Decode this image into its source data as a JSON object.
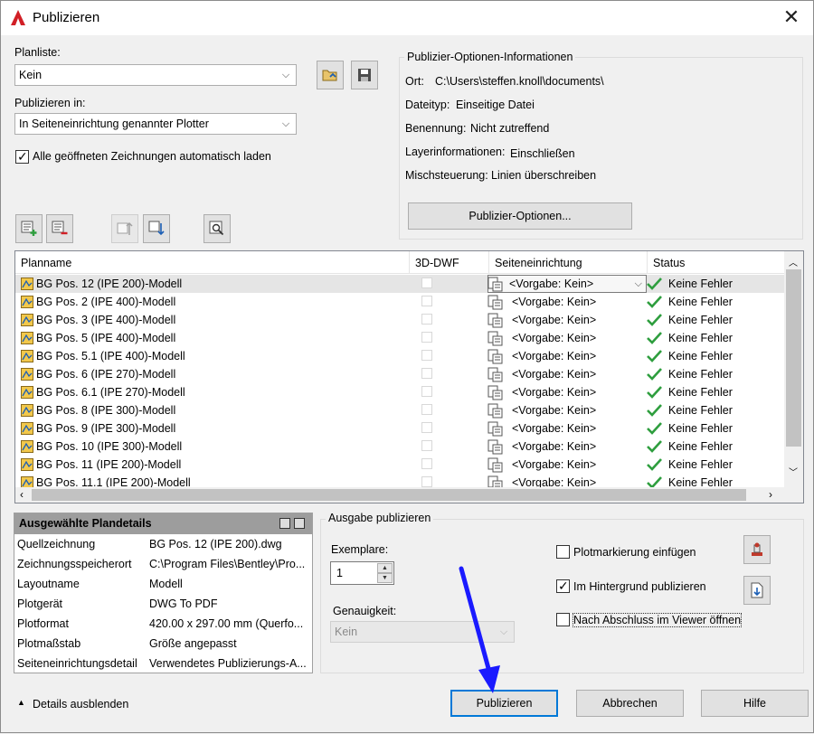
{
  "window": {
    "title": "Publizieren"
  },
  "planliste": {
    "label": "Planliste:",
    "value": "Kein"
  },
  "publizieren_in": {
    "label": "Publizieren in:",
    "value": "In Seiteneinrichtung genannter Plotter"
  },
  "auto_load": {
    "label": "Alle geöffneten Zeichnungen automatisch laden",
    "checked": true
  },
  "info": {
    "title": "Publizier-Optionen-Informationen",
    "rows": [
      {
        "key": "Ort:",
        "value": "C:\\Users\\steffen.knoll\\documents\\"
      },
      {
        "key": "Dateityp:",
        "value": "Einseitige Datei"
      },
      {
        "key": "Benennung:",
        "value": "Nicht zutreffend"
      },
      {
        "key": "Layerinformationen:",
        "value": "Einschließen"
      },
      {
        "key": "Mischsteuerung:",
        "value": "Linien überschreiben"
      }
    ],
    "button": "Publizier-Optionen..."
  },
  "table": {
    "headers": [
      "Planname",
      "3D-DWF",
      "Seiteneinrichtung",
      "Status"
    ],
    "rows": [
      {
        "name": "BG Pos. 12 (IPE 200)-Modell",
        "setup": "<Vorgabe: Kein>",
        "status": "Keine Fehler"
      },
      {
        "name": "BG Pos. 2 (IPE 400)-Modell",
        "setup": "<Vorgabe: Kein>",
        "status": "Keine Fehler"
      },
      {
        "name": "BG Pos. 3 (IPE 400)-Modell",
        "setup": "<Vorgabe: Kein>",
        "status": "Keine Fehler"
      },
      {
        "name": "BG Pos. 5 (IPE 400)-Modell",
        "setup": "<Vorgabe: Kein>",
        "status": "Keine Fehler"
      },
      {
        "name": "BG Pos. 5.1 (IPE 400)-Modell",
        "setup": "<Vorgabe: Kein>",
        "status": "Keine Fehler"
      },
      {
        "name": "BG Pos. 6 (IPE 270)-Modell",
        "setup": "<Vorgabe: Kein>",
        "status": "Keine Fehler"
      },
      {
        "name": "BG Pos. 6.1 (IPE 270)-Modell",
        "setup": "<Vorgabe: Kein>",
        "status": "Keine Fehler"
      },
      {
        "name": "BG Pos. 8 (IPE 300)-Modell",
        "setup": "<Vorgabe: Kein>",
        "status": "Keine Fehler"
      },
      {
        "name": "BG Pos. 9 (IPE 300)-Modell",
        "setup": "<Vorgabe: Kein>",
        "status": "Keine Fehler"
      },
      {
        "name": "BG Pos. 10 (IPE 300)-Modell",
        "setup": "<Vorgabe: Kein>",
        "status": "Keine Fehler"
      },
      {
        "name": "BG Pos. 11 (IPE 200)-Modell",
        "setup": "<Vorgabe: Kein>",
        "status": "Keine Fehler"
      },
      {
        "name": "BG Pos. 11.1 (IPE 200)-Modell",
        "setup": "<Vorgabe: Kein>",
        "status": "Keine Fehler"
      }
    ]
  },
  "details": {
    "title": "Ausgewählte Plandetails",
    "rows": [
      {
        "key": "Quellzeichnung",
        "value": "BG Pos. 12 (IPE 200).dwg"
      },
      {
        "key": "Zeichnungsspeicherort",
        "value": "C:\\Program Files\\Bentley\\Pro..."
      },
      {
        "key": "Layoutname",
        "value": "Modell"
      },
      {
        "key": "Plotgerät",
        "value": "DWG To PDF"
      },
      {
        "key": "Plotformat",
        "value": "420.00 x 297.00 mm (Querfo..."
      },
      {
        "key": "Plotmaßstab",
        "value": "Größe angepasst"
      },
      {
        "key": "Seiteneinrichtungsdetail",
        "value": "Verwendetes Publizierungs-A..."
      }
    ]
  },
  "ausgabe": {
    "title": "Ausgabe publizieren",
    "exemplare_label": "Exemplare:",
    "exemplare_value": "1",
    "genauigkeit_label": "Genauigkeit:",
    "genauigkeit_value": "Kein",
    "plotmarkierung": {
      "label": "Plotmarkierung einfügen",
      "checked": false
    },
    "hintergrund": {
      "label": "Im Hintergrund publizieren",
      "checked": true
    },
    "viewer": {
      "label": "Nach Abschluss im Viewer öffnen",
      "checked": false
    }
  },
  "footer": {
    "details_toggle": "Details ausblenden",
    "publish": "Publizieren",
    "cancel": "Abbrechen",
    "help": "Hilfe"
  },
  "colors": {
    "accent": "#0078d7",
    "arrow": "#1a1aff",
    "status_ok": "#2e9e3e"
  }
}
